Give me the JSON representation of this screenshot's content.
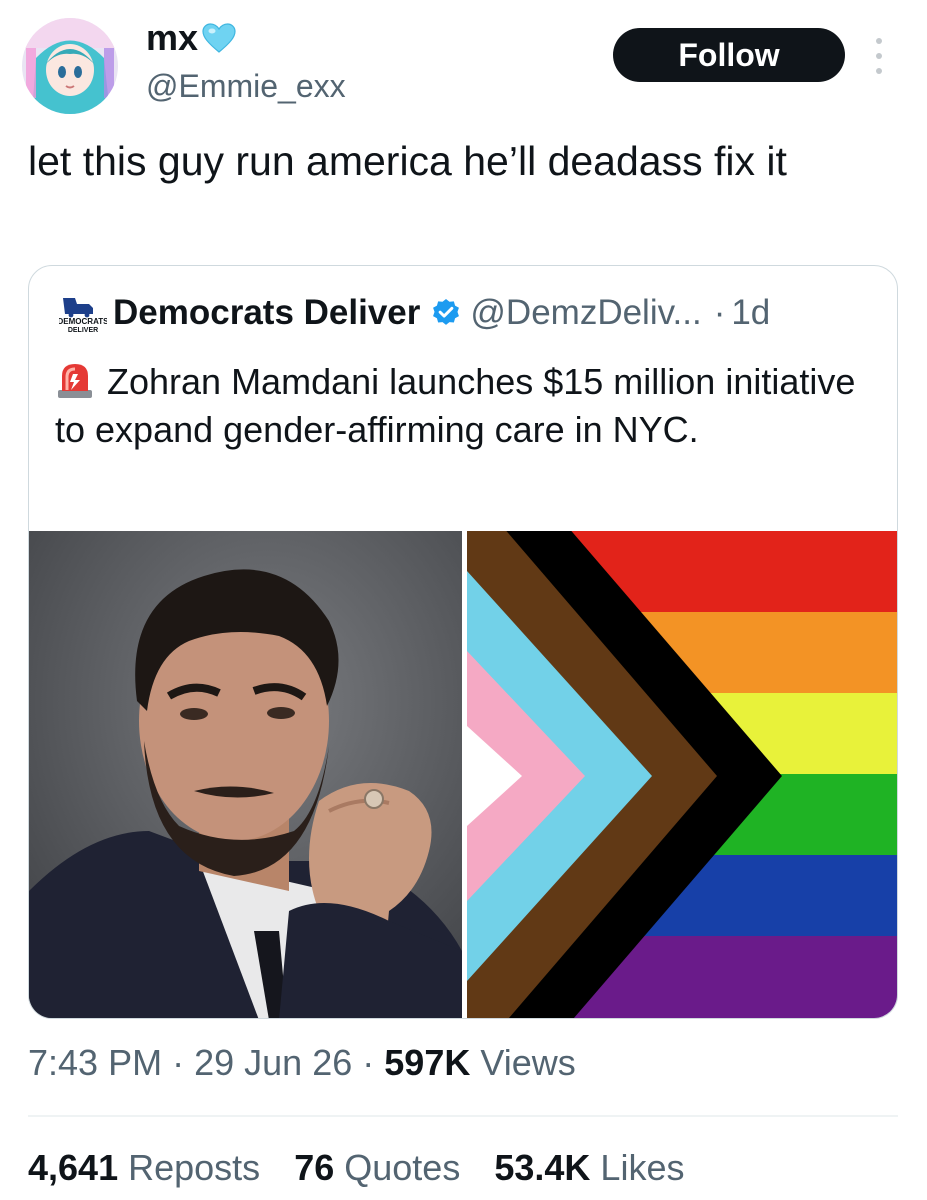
{
  "author": {
    "display_name": "mx",
    "handle": "@Emmie_exx",
    "avatar_icon": "anime-avatar",
    "name_badge_icon": "light-blue-heart-icon"
  },
  "follow_label": "Follow",
  "tweet_text": "let this guy run america he’ll deadass fix it",
  "quote": {
    "logo_text_line1": "DEMOCRATS",
    "logo_text_line2": "DELIVER",
    "name": "Democrats Deliver",
    "handle": "@DemzDeliv...",
    "separator": "·",
    "age": "1d",
    "siren_icon": "rotating-light-icon",
    "text": "Zohran Mamdani launches $15 million initiative to expand gender-affirming care in NYC."
  },
  "meta": {
    "time": "7:43 PM",
    "date": "29 Jun 26",
    "views_count": "597K",
    "views_label": "Views",
    "dot": "·"
  },
  "stats": {
    "reposts_count": "4,641",
    "reposts_label": "Reposts",
    "quotes_count": "76",
    "quotes_label": "Quotes",
    "likes_count": "53.4K",
    "likes_label": "Likes"
  },
  "colors": {
    "follow_bg": "#0f1419",
    "secondary_text": "#536471",
    "verified_blue": "#1d9bf0",
    "flag_stripes": [
      "#e2231a",
      "#f39325",
      "#e8f23a",
      "#1fb324",
      "#1740a8",
      "#6a1b8a"
    ],
    "flag_chevrons": [
      "#ffffff",
      "#f5a9c4",
      "#72d1e8",
      "#613915",
      "#000000"
    ]
  }
}
